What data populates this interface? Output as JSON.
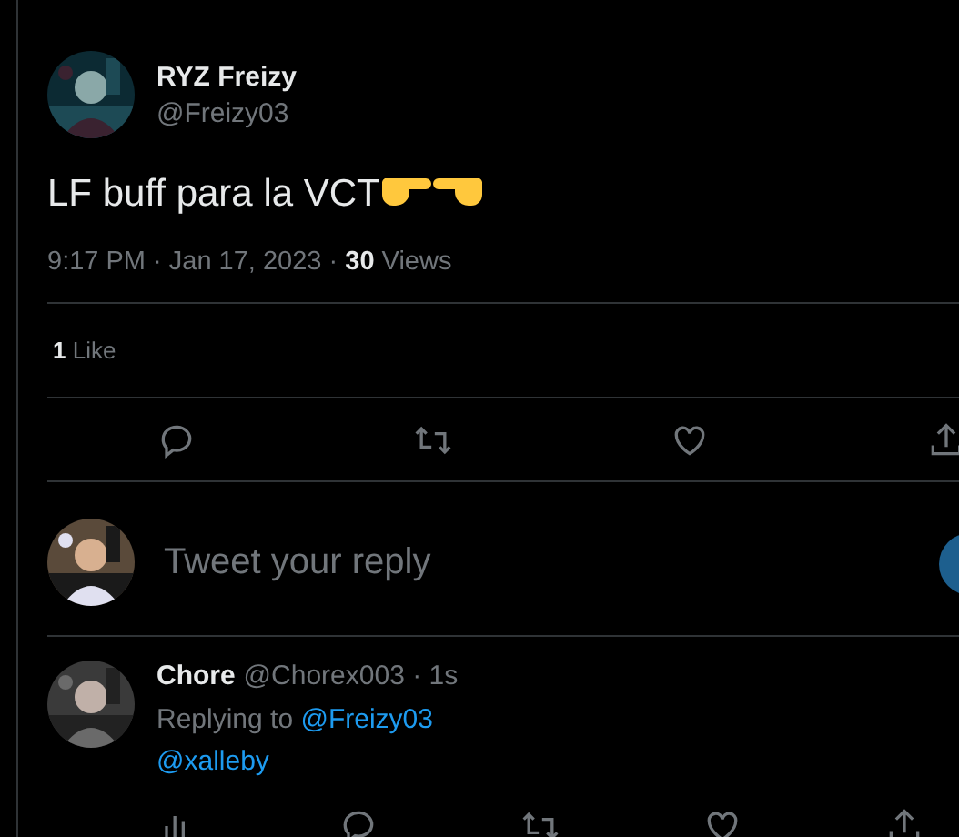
{
  "tweet": {
    "author": {
      "name": "RYZ Freizy",
      "handle": "@Freizy03"
    },
    "text": "LF buff para la VCT",
    "meta": "9:17 PM · Jan 17, 2023 · **30** Views",
    "likes": "**1** Like"
  },
  "composer": {
    "placeholder": "Tweet your reply"
  },
  "replies": [
    {
      "name": "Chore",
      "handle": "@Chorex003 · 1s",
      "replying_label": "Replying to",
      "replying_to": "@Freizy03",
      "text": "@xalleby"
    }
  ]
}
